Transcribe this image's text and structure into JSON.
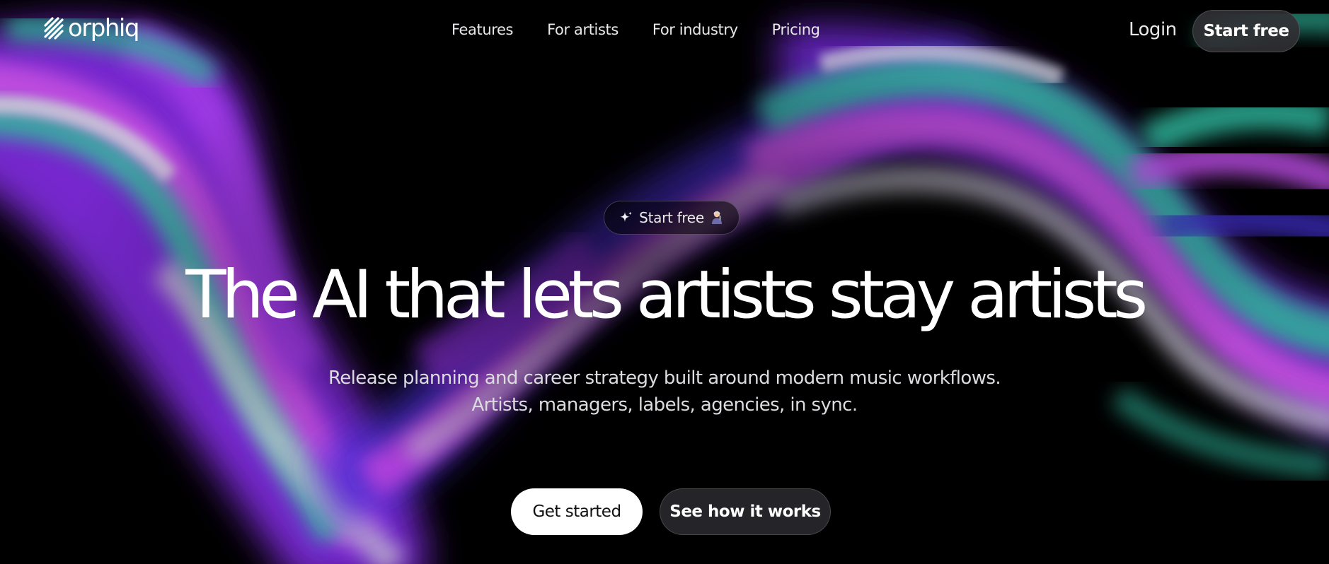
{
  "brand": {
    "name": "orphiq",
    "logo_icon": "orphiq-logo-icon"
  },
  "nav": {
    "items": [
      {
        "label": "Features"
      },
      {
        "label": "For artists"
      },
      {
        "label": "For industry"
      },
      {
        "label": "Pricing"
      }
    ],
    "login_label": "Login",
    "cta_label": "Start free"
  },
  "hero": {
    "pill": {
      "label": "Start free",
      "icon": "sparkle-icon",
      "emoji_icon": "artist-emoji-icon"
    },
    "headline": "The AI that lets artists stay artists",
    "subtitle_line1": "Release planning and career strategy built around modern music workflows.",
    "subtitle_line2": "Artists, managers, labels, agencies, in sync.",
    "primary_cta": "Get started",
    "secondary_cta": "See how it works"
  },
  "colors": {
    "background": "#000000",
    "ribbon_purple": "#8a2be2",
    "ribbon_magenta": "#c44fd8",
    "ribbon_teal": "#2fb39a",
    "ribbon_silver": "#c9c6d2",
    "ribbon_indigo": "#3d2fb0",
    "primary_button": "#ffffff",
    "secondary_button": "#28282c"
  }
}
